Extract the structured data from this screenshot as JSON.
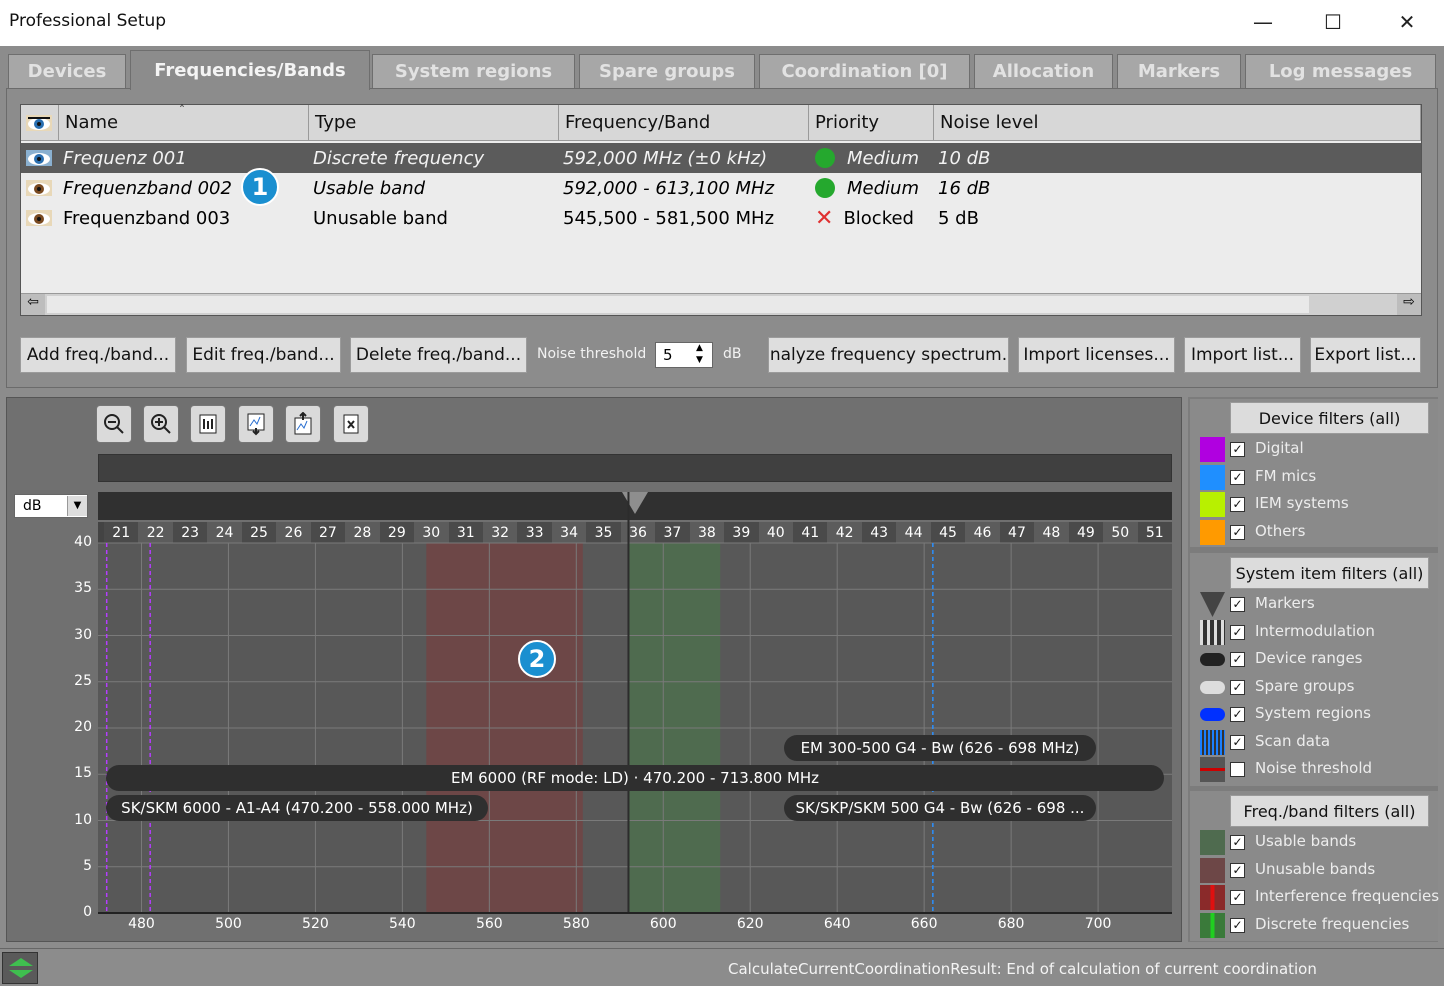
{
  "window": {
    "title": "Professional Setup",
    "minimize": "—",
    "maximize": "☐",
    "close": "✕"
  },
  "tabs": [
    "Devices",
    "Frequencies/Bands",
    "System regions",
    "Spare groups",
    "Coordination [0]",
    "Allocation",
    "Markers",
    "Log messages"
  ],
  "active_tab": "Frequencies/Bands",
  "table": {
    "columns": [
      "Name",
      "Type",
      "Frequency/Band",
      "Priority",
      "Noise level"
    ],
    "rows": [
      {
        "name": "Frequenz 001",
        "type": "Discrete frequency",
        "freq": "592,000 MHz (±0 kHz)",
        "priority": "Medium",
        "noise": "10 dB",
        "icon": "eye-icon",
        "priority_icon": "green-dot-icon"
      },
      {
        "name": "Frequenzband 002",
        "type": "Usable band",
        "freq": "592,000 - 613,100 MHz",
        "priority": "Medium",
        "noise": "16 dB",
        "icon": "eye-icon",
        "priority_icon": "green-dot-icon"
      },
      {
        "name": "Frequenzband 003",
        "type": "Unusable band",
        "freq": "545,500 - 581,500 MHz",
        "priority": "Blocked",
        "noise": "5 dB",
        "icon": "eye-icon",
        "priority_icon": "red-x-icon"
      }
    ]
  },
  "callouts": [
    "1",
    "2"
  ],
  "buttons": {
    "add": "Add freq./band...",
    "edit": "Edit freq./band...",
    "delete": "Delete freq./band...",
    "analyze": "nalyze frequency spectrum.",
    "import_licenses": "Import licenses...",
    "import_list": "Import list...",
    "export_list": "Export list..."
  },
  "noise_threshold": {
    "label": "Noise threshold",
    "value": "5",
    "unit": "dB"
  },
  "unit_select": "dB",
  "chart_data": {
    "type": "band-plot",
    "x_ticks": [
      480,
      500,
      520,
      540,
      560,
      580,
      600,
      620,
      640,
      660,
      680,
      700
    ],
    "x_range": [
      470,
      717
    ],
    "y_ticks": [
      0,
      5,
      10,
      15,
      20,
      25,
      30,
      35,
      40
    ],
    "y_range": [
      0,
      40
    ],
    "channels": [
      "21",
      "22",
      "23",
      "24",
      "25",
      "26",
      "27",
      "28",
      "29",
      "30",
      "31",
      "32",
      "33",
      "34",
      "35",
      "36",
      "37",
      "38",
      "39",
      "40",
      "41",
      "42",
      "43",
      "44",
      "45",
      "46",
      "47",
      "48",
      "49",
      "50",
      "51"
    ],
    "bands": [
      {
        "type": "unusable",
        "from": 545.5,
        "to": 581.5,
        "color": "#6d4747"
      },
      {
        "type": "usable",
        "from": 592.0,
        "to": 613.1,
        "color": "#4f6b4f"
      }
    ],
    "discrete_lines": [
      592.0
    ],
    "marker_lines": [
      {
        "x": 472,
        "color": "#b53cff"
      },
      {
        "x": 482,
        "color": "#b53cff"
      },
      {
        "x": 662,
        "color": "#2b8fff"
      }
    ],
    "device_ranges": [
      {
        "label": "EM 300-500 G4 - Bw (626 - 698 MHz)",
        "from": 626,
        "to": 698,
        "row": 0
      },
      {
        "label": "EM 6000 (RF mode: LD) · 470.200 - 713.800 MHz",
        "from": 470.2,
        "to": 713.8,
        "row": 1
      },
      {
        "label": "SK/SKM 6000 - A1-A4 (470.200 - 558.000 MHz)",
        "from": 470.2,
        "to": 558,
        "row": 2
      },
      {
        "label": "SK/SKP/SKM 500 G4 - Bw (626 - 698 ...",
        "from": 626,
        "to": 698,
        "row": 2
      }
    ]
  },
  "device_filters": {
    "title": "Device filters (all)",
    "items": [
      {
        "label": "Digital",
        "color": "#b000e0",
        "checked": true
      },
      {
        "label": "FM mics",
        "color": "#1f8fff",
        "checked": true
      },
      {
        "label": "IEM systems",
        "color": "#b8f000",
        "checked": true
      },
      {
        "label": "Others",
        "color": "#ff9a00",
        "checked": true
      }
    ]
  },
  "system_filters": {
    "title": "System item filters (all)",
    "items": [
      {
        "label": "Markers",
        "checked": true
      },
      {
        "label": "Intermodulation",
        "checked": true
      },
      {
        "label": "Device ranges",
        "checked": true
      },
      {
        "label": "Spare groups",
        "checked": true
      },
      {
        "label": "System regions",
        "checked": true
      },
      {
        "label": "Scan data",
        "checked": true
      },
      {
        "label": "Noise threshold",
        "checked": false
      }
    ]
  },
  "band_filters": {
    "title": "Freq./band filters (all)",
    "items": [
      {
        "label": "Usable bands",
        "color": "#4f6b4f",
        "checked": true
      },
      {
        "label": "Unusable bands",
        "color": "#6d4747",
        "checked": true
      },
      {
        "label": "Interference frequencies",
        "color": "#8a2a2a",
        "checked": true
      },
      {
        "label": "Discrete frequencies",
        "color": "#3a7a3a",
        "checked": true
      }
    ]
  },
  "status": {
    "message": "CalculateCurrentCoordinationResult: End of calculation of current coordination"
  }
}
